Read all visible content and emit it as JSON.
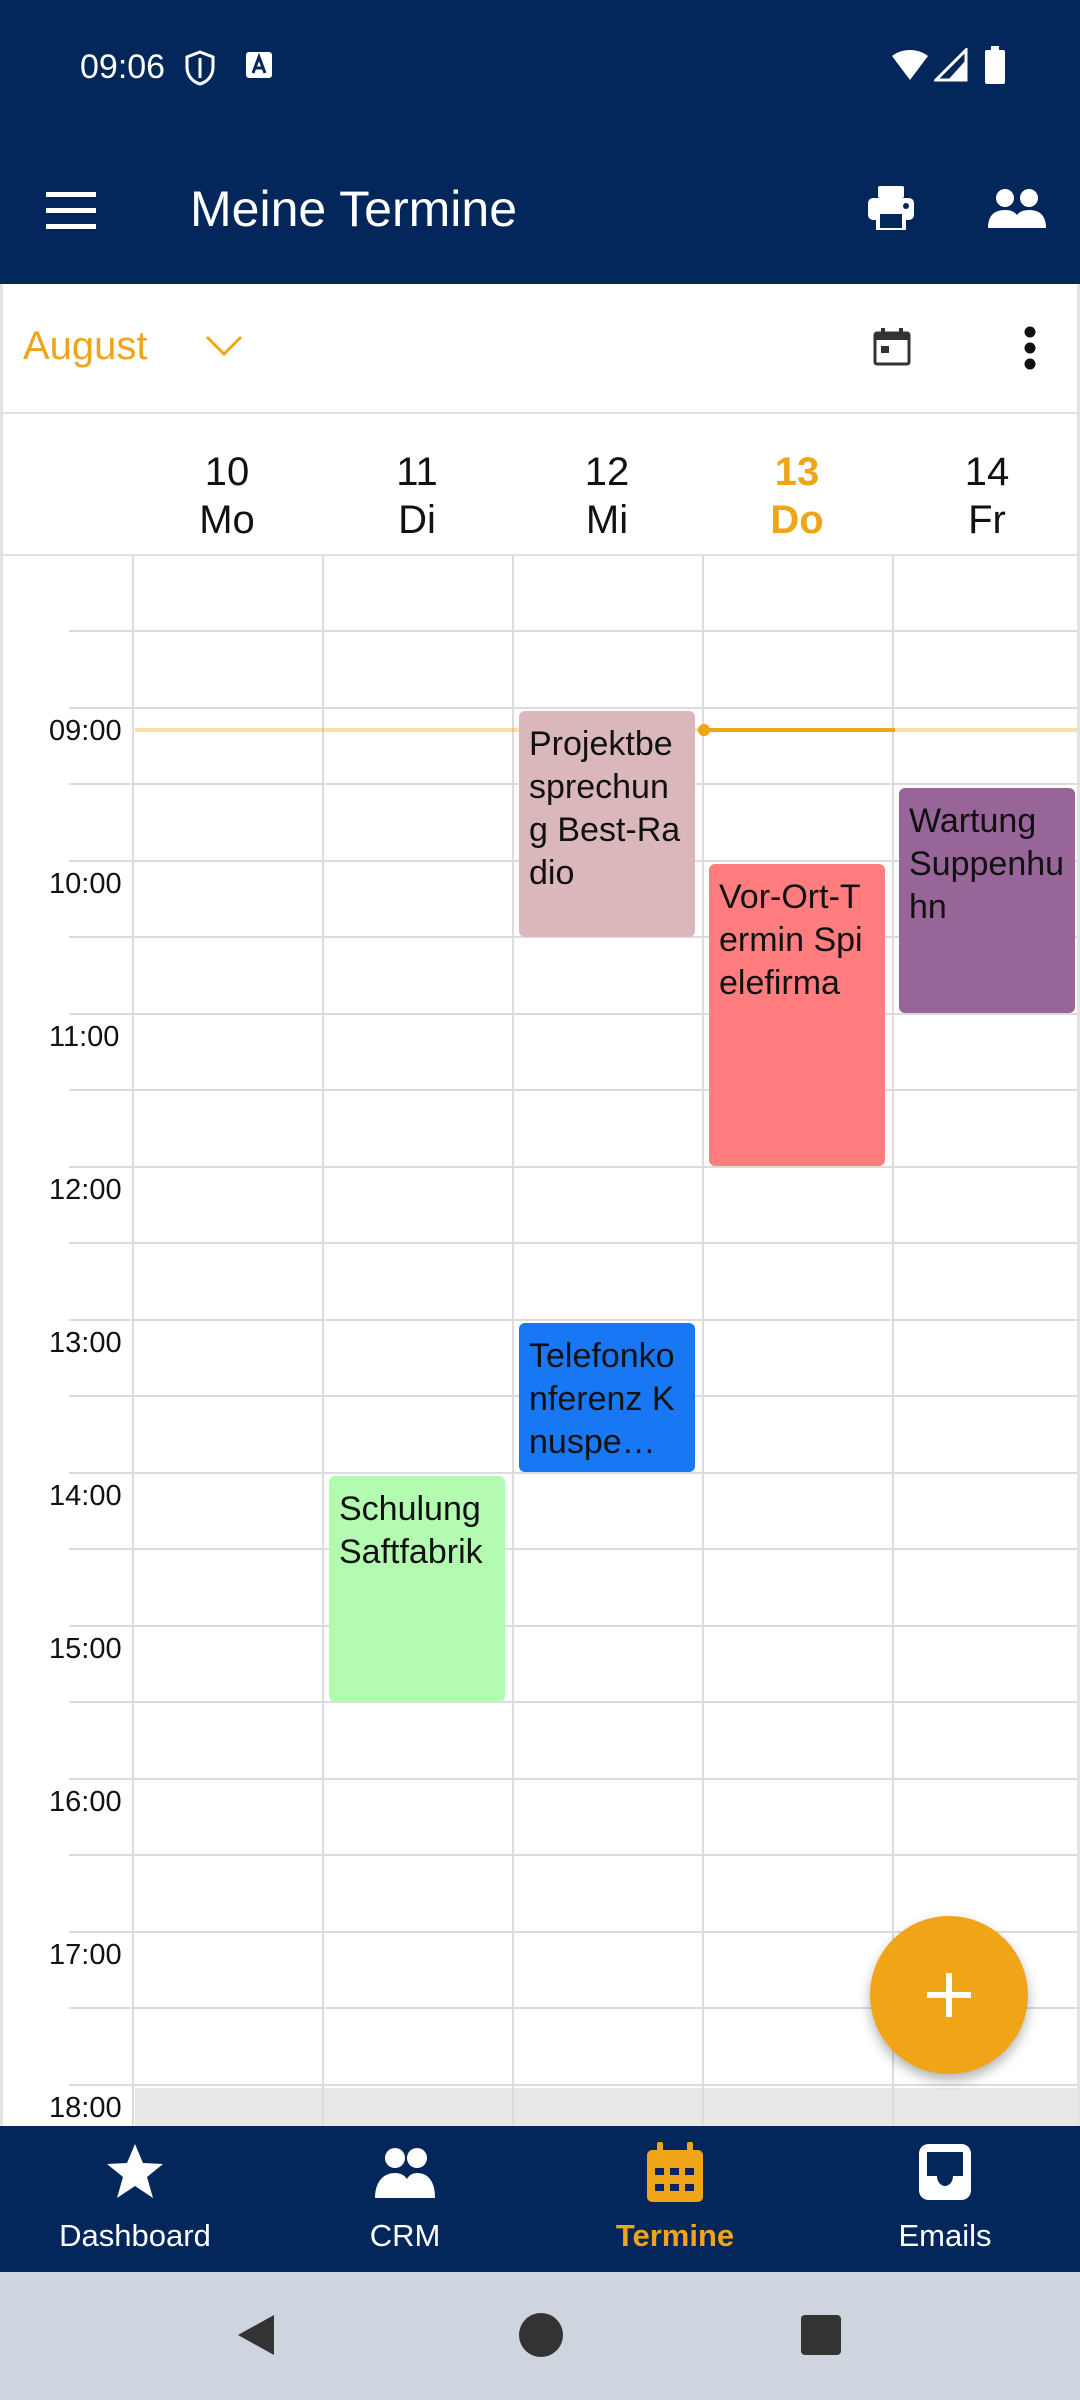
{
  "status_bar": {
    "time": "09:06"
  },
  "app_bar": {
    "title": "Meine Termine"
  },
  "toolbar": {
    "month": "August"
  },
  "days": [
    {
      "num": "10",
      "name": "Mo",
      "today": false
    },
    {
      "num": "11",
      "name": "Di",
      "today": false
    },
    {
      "num": "12",
      "name": "Mi",
      "today": false
    },
    {
      "num": "13",
      "name": "Do",
      "today": true
    },
    {
      "num": "14",
      "name": "Fr",
      "today": false
    }
  ],
  "time_labels": [
    "09:00",
    "10:00",
    "11:00",
    "12:00",
    "13:00",
    "14:00",
    "15:00",
    "16:00",
    "17:00",
    "18:00"
  ],
  "current_time": "09:06",
  "events": [
    {
      "title": "Projektbesprechung Best-Radio",
      "day": "Mi",
      "start": "09:00",
      "end": "10:30",
      "color": "#dab7bb"
    },
    {
      "title": "Vor-Ort-Termin Spielefirma",
      "day": "Do",
      "start": "10:00",
      "end": "12:00",
      "color": "#ff7d7e"
    },
    {
      "title": "Wartung Suppenhuhn",
      "day": "Fr",
      "start": "09:30",
      "end": "11:00",
      "color": "#976597"
    },
    {
      "title": "Telefonkonferenz Knuspe…",
      "day": "Mi",
      "start": "13:00",
      "end": "14:00",
      "color": "#1877f2"
    },
    {
      "title": "Schulung Saftfabrik",
      "day": "Di",
      "start": "14:00",
      "end": "15:30",
      "color": "#b3fbb0"
    }
  ],
  "bottom_nav": [
    {
      "label": "Dashboard",
      "icon": "star-icon",
      "active": false
    },
    {
      "label": "CRM",
      "icon": "people-icon",
      "active": false
    },
    {
      "label": "Termine",
      "icon": "calendar-icon",
      "active": true
    },
    {
      "label": "Emails",
      "icon": "inbox-icon",
      "active": false
    }
  ],
  "colors": {
    "primary": "#03275a",
    "accent": "#f0a418",
    "now_line": "#f0a418"
  }
}
